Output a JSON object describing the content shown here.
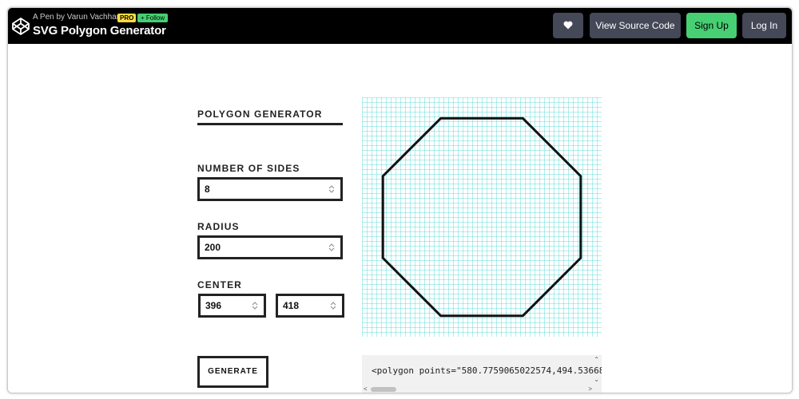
{
  "header": {
    "pen_by": "A Pen by Varun Vachhar",
    "pro_badge": "PRO",
    "follow_label": "+ Follow",
    "title": "SVG Polygon Generator",
    "heart_icon": "heart-icon",
    "view_source_label": "View Source Code",
    "signup_label": "Sign Up",
    "login_label": "Log In",
    "colors": {
      "bar": "#000000",
      "button": "#444857",
      "signup": "#47cf73",
      "pro": "#ffdd40"
    }
  },
  "generator": {
    "title": "POLYGON GENERATOR",
    "sides_label": "NUMBER OF SIDES",
    "sides_value": "8",
    "radius_label": "RADIUS",
    "radius_value": "200",
    "center_label": "CENTER",
    "center_x_value": "396",
    "center_y_value": "418",
    "generate_label": "GENERATE"
  },
  "preview": {
    "grid_color": "#40d2d2",
    "polygon_sides": 8
  },
  "output": {
    "code_text": "<polygon points=\"580.7759065022574,494.53668"
  }
}
